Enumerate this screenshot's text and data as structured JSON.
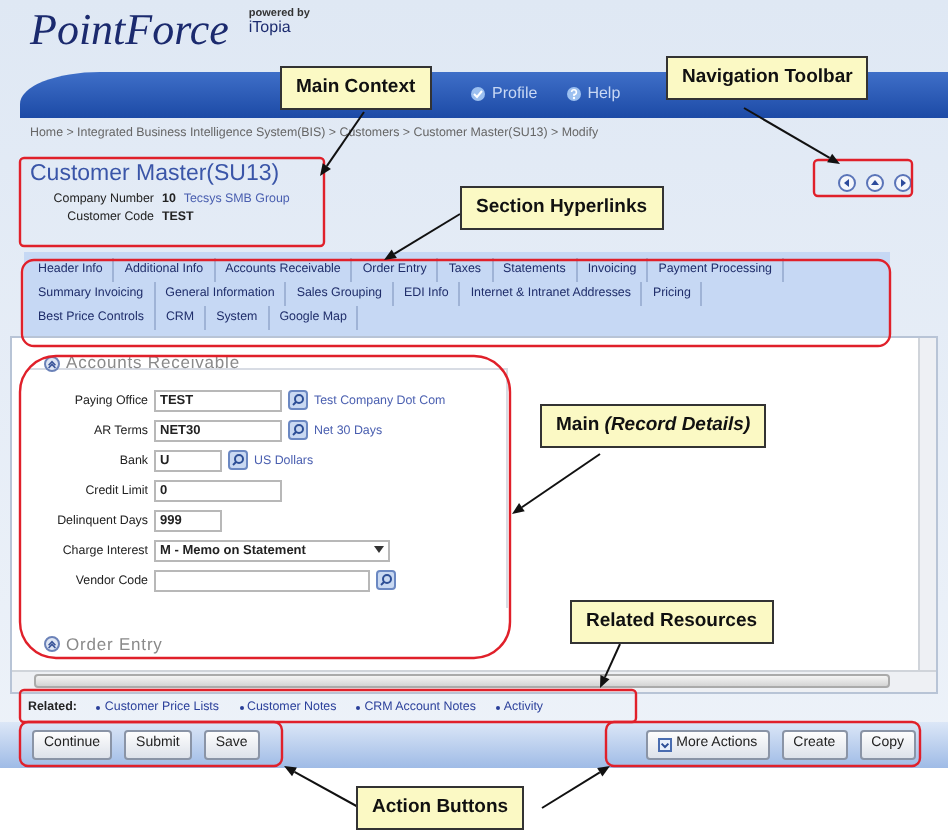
{
  "header": {
    "logo": "PointForce",
    "powered_by": "powered by",
    "brand": "iTopia",
    "menu": [
      "Profile",
      "Help"
    ]
  },
  "breadcrumb": "Home > Integrated Business Intelligence System(BIS) > Customers > Customer Master(SU13) > Modify",
  "title": "Customer Master(SU13)",
  "context": [
    {
      "label": "Company Number",
      "value": "10",
      "link": "Tecsys SMB Group"
    },
    {
      "label": "Customer Code",
      "value": "TEST"
    }
  ],
  "section_link_rows": [
    {
      "links": [
        "Header Info",
        "Additional Info",
        "Accounts Receivable",
        "Order Entry",
        "Taxes",
        "Statements",
        "Invoicing",
        "Payment Processing"
      ]
    },
    {
      "links": [
        "Summary Invoicing",
        "General Information",
        "Sales Grouping",
        "EDI Info",
        "Internet & Intranet Addresses",
        "Pricing"
      ]
    },
    {
      "links": [
        "Best Price Controls",
        "CRM",
        "System",
        "Google Map"
      ]
    }
  ],
  "sections": [
    {
      "title": "Accounts Receivable",
      "fields": [
        {
          "label": "Paying Office",
          "kind": "lookup",
          "value": "TEST",
          "description": "Test Company Dot Com"
        },
        {
          "label": "AR Terms",
          "kind": "lookup",
          "value": "NET30",
          "description": "Net 30 Days"
        },
        {
          "label": "Bank",
          "kind": "lookup",
          "value": "U",
          "description": "US Dollars"
        },
        {
          "label": "Credit Limit",
          "kind": "text",
          "value": "0"
        },
        {
          "label": "Delinquent Days",
          "kind": "text",
          "value": "999"
        },
        {
          "label": "Charge Interest",
          "kind": "select",
          "value": "M - Memo on Statement"
        },
        {
          "label": "Vendor Code",
          "kind": "lookup"
        }
      ]
    },
    {
      "title": "Order Entry"
    }
  ],
  "related": {
    "label": "Related:",
    "links": [
      "Customer Price Lists",
      "Customer Notes",
      "CRM Account Notes",
      "Activity"
    ]
  },
  "actions_left": [
    {
      "label": "Continue"
    },
    {
      "label": "Submit"
    },
    {
      "label": "Save"
    }
  ],
  "actions_right": [
    {
      "label": "More Actions",
      "kind": "menu"
    },
    {
      "label": "Create",
      "kind": "button"
    },
    {
      "label": "Copy",
      "kind": "button"
    }
  ],
  "callouts": [
    {
      "text": "Main Context"
    },
    {
      "text": "Navigation Toolbar"
    },
    {
      "text": "Section Hyperlinks"
    },
    {
      "text": "Main *(Record Details)*"
    },
    {
      "text": "Related Resources"
    },
    {
      "text": "Action Buttons"
    }
  ]
}
